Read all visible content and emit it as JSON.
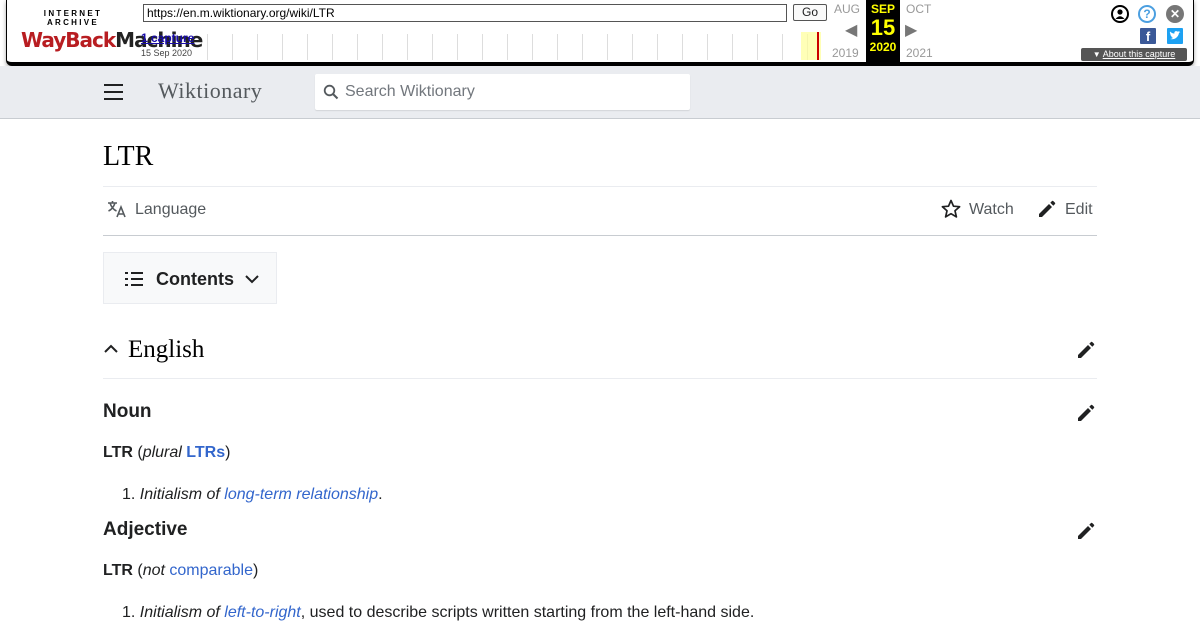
{
  "wayback": {
    "logo_top": "INTERNET ARCHIVE",
    "logo_word1": "WayBack",
    "logo_word2": "Machine",
    "url": "https://en.m.wiktionary.org/wiki/LTR",
    "go_label": "Go",
    "captures_label": "1 capture",
    "captures_date": "15 Sep 2020",
    "prev_month": "AUG",
    "prev_year": "2019",
    "cur_month": "SEP",
    "cur_day": "15",
    "cur_year": "2020",
    "next_month": "OCT",
    "next_year": "2021",
    "about_label": "About this capture",
    "colors": {
      "highlight": "#ffff99",
      "capture": "#cc0000",
      "current_bg": "#000000",
      "current_fg": "#ffff00"
    }
  },
  "header": {
    "brand": "Wiktionary",
    "search_placeholder": "Search Wiktionary"
  },
  "page": {
    "title": "LTR",
    "actions": {
      "language": "Language",
      "watch": "Watch",
      "edit": "Edit"
    },
    "toc_label": "Contents",
    "section_english": "English",
    "noun": {
      "heading": "Noun",
      "headword": "LTR",
      "paren_open": "(",
      "plural_label": "plural",
      "plural_form": "LTRs",
      "paren_close": ")",
      "def_number": "1.",
      "def_prefix": "Initialism of",
      "def_link": "long-term relationship",
      "def_suffix": "."
    },
    "adjective": {
      "heading": "Adjective",
      "headword": "LTR",
      "paren_open": "(",
      "not_label": "not",
      "comparable_link": "comparable",
      "paren_close": ")",
      "def_number": "1.",
      "def_prefix": "Initialism of",
      "def_link": "left-to-right",
      "def_suffix": ", used to describe scripts written starting from the left-hand side."
    }
  },
  "icons": [
    "translate-icon",
    "star-icon",
    "pencil-icon",
    "list-icon",
    "chevron-down-icon",
    "chevron-up-icon",
    "search-icon",
    "menu-icon",
    "user-icon",
    "help-icon",
    "close-icon",
    "facebook-icon",
    "twitter-icon"
  ],
  "accent_colors": {
    "link": "#3366cc",
    "text": "#202122",
    "muted": "#54595d",
    "header_bg": "#eaecf0"
  }
}
